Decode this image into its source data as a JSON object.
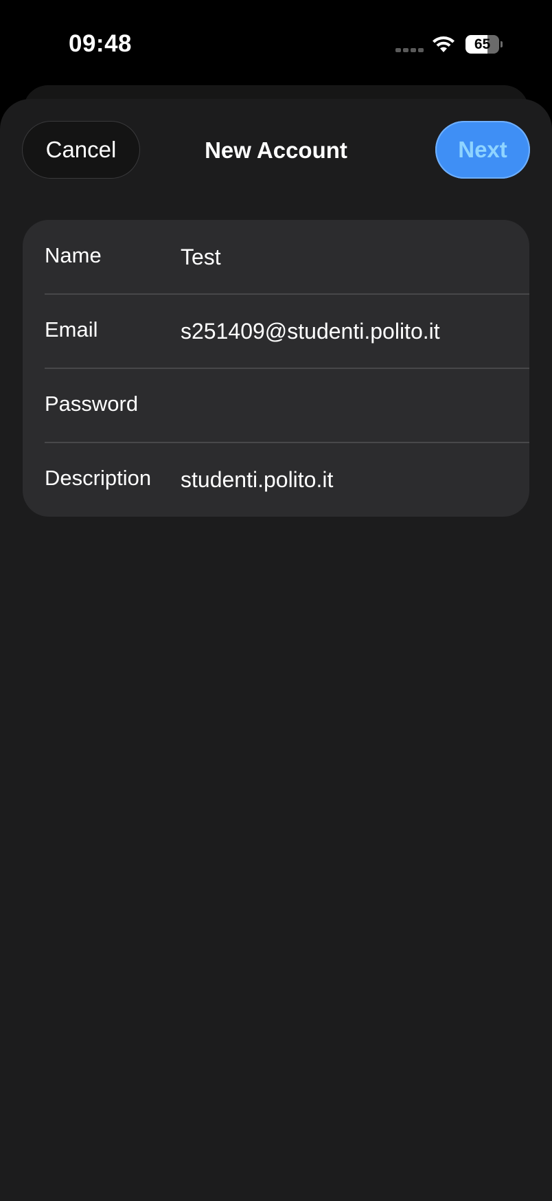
{
  "status_bar": {
    "time": "09:48",
    "battery_level": "65",
    "signal_icon": "cellular-dots-icon",
    "wifi_icon": "wifi-icon",
    "battery_icon": "battery-icon"
  },
  "nav": {
    "cancel_label": "Cancel",
    "title": "New Account",
    "next_label": "Next"
  },
  "form": {
    "fields": [
      {
        "label": "Name",
        "value": "Test"
      },
      {
        "label": "Email",
        "value": "s251409@studenti.polito.it"
      },
      {
        "label": "Password",
        "value": ""
      },
      {
        "label": "Description",
        "value": "studenti.polito.it"
      }
    ]
  },
  "colors": {
    "accent": "#3f8ff5",
    "accent_text": "#8fd4ff",
    "sheet_bg": "#1c1c1d",
    "card_bg": "#2c2c2e"
  }
}
